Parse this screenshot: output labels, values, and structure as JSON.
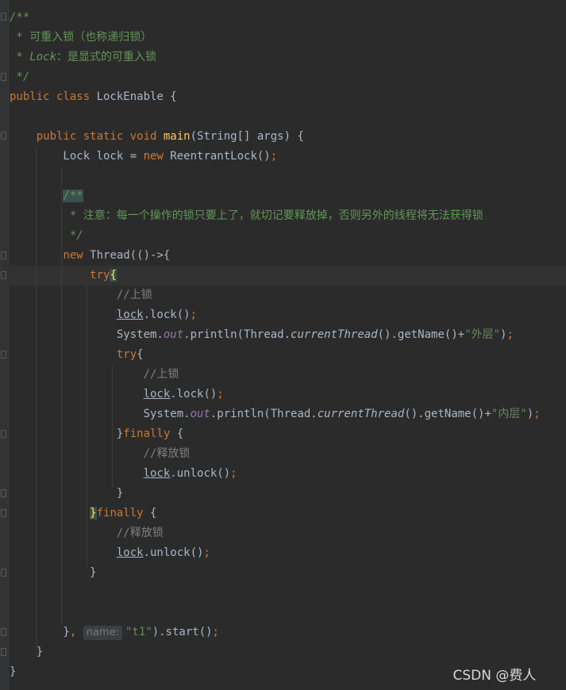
{
  "editor": {
    "language": "java",
    "lines": [
      {
        "tokens": [
          {
            "t": "/**",
            "c": "tok-comment"
          }
        ]
      },
      {
        "tokens": [
          {
            "t": " * 可重入锁（也称递归锁）",
            "c": "tok-doc"
          }
        ]
      },
      {
        "tokens": [
          {
            "t": " * ",
            "c": "tok-doc"
          },
          {
            "t": "Lock",
            "c": "tok-comment"
          },
          {
            "t": "：是显式的可重入锁",
            "c": "tok-doc"
          }
        ]
      },
      {
        "tokens": [
          {
            "t": " */",
            "c": "tok-comment"
          }
        ]
      },
      {
        "tokens": [
          {
            "t": "public class ",
            "c": "tok-kw"
          },
          {
            "t": "LockEnable {",
            "c": ""
          }
        ]
      },
      {
        "tokens": []
      },
      {
        "tokens": [
          {
            "t": "    public static void ",
            "c": "tok-kw"
          },
          {
            "t": "main",
            "c": "tok-method"
          },
          {
            "t": "(String[] args) {",
            "c": ""
          }
        ]
      },
      {
        "tokens": [
          {
            "t": "        Lock lock = ",
            "c": ""
          },
          {
            "t": "new ",
            "c": "tok-kw"
          },
          {
            "t": "ReentrantLock()",
            "c": ""
          },
          {
            "t": ";",
            "c": "tok-semicolon"
          }
        ]
      },
      {
        "tokens": []
      },
      {
        "tokens": [
          {
            "t": "        ",
            "c": ""
          },
          {
            "t": "/**",
            "c": "tok-comment tok-doc-hl"
          }
        ]
      },
      {
        "tokens": [
          {
            "t": "         * 注意：每一个操作的锁只要上了，就切记要释放掉，否则另外的线程将无法获得锁",
            "c": "tok-doc"
          }
        ]
      },
      {
        "tokens": [
          {
            "t": "         */",
            "c": "tok-comment"
          }
        ]
      },
      {
        "tokens": [
          {
            "t": "        ",
            "c": ""
          },
          {
            "t": "new ",
            "c": "tok-kw"
          },
          {
            "t": "Thread(()->{",
            "c": ""
          }
        ]
      },
      {
        "tokens": [
          {
            "t": "            ",
            "c": ""
          },
          {
            "t": "try",
            "c": "tok-kw"
          },
          {
            "t": "{",
            "c": "tok-brace-hl"
          }
        ]
      },
      {
        "tokens": [
          {
            "t": "                ",
            "c": ""
          },
          {
            "t": "//上锁",
            "c": "tok-line-comment"
          }
        ]
      },
      {
        "tokens": [
          {
            "t": "                ",
            "c": ""
          },
          {
            "t": "lock",
            "c": "tok-underline"
          },
          {
            "t": ".lock()",
            "c": ""
          },
          {
            "t": ";",
            "c": "tok-semicolon"
          }
        ]
      },
      {
        "tokens": [
          {
            "t": "                System.",
            "c": ""
          },
          {
            "t": "out",
            "c": "tok-static"
          },
          {
            "t": ".println(Thread.",
            "c": ""
          },
          {
            "t": "currentThread",
            "c": "tok-italic"
          },
          {
            "t": "().getName()+",
            "c": ""
          },
          {
            "t": "\"外层\"",
            "c": "tok-str"
          },
          {
            "t": ")",
            "c": ""
          },
          {
            "t": ";",
            "c": "tok-semicolon"
          }
        ]
      },
      {
        "tokens": [
          {
            "t": "                ",
            "c": ""
          },
          {
            "t": "try",
            "c": "tok-kw"
          },
          {
            "t": "{",
            "c": ""
          }
        ]
      },
      {
        "tokens": [
          {
            "t": "                    ",
            "c": ""
          },
          {
            "t": "//上锁",
            "c": "tok-line-comment"
          }
        ]
      },
      {
        "tokens": [
          {
            "t": "                    ",
            "c": ""
          },
          {
            "t": "lock",
            "c": "tok-underline"
          },
          {
            "t": ".lock()",
            "c": ""
          },
          {
            "t": ";",
            "c": "tok-semicolon"
          }
        ]
      },
      {
        "tokens": [
          {
            "t": "                    System.",
            "c": ""
          },
          {
            "t": "out",
            "c": "tok-static"
          },
          {
            "t": ".println(Thread.",
            "c": ""
          },
          {
            "t": "currentThread",
            "c": "tok-italic"
          },
          {
            "t": "().getName()+",
            "c": ""
          },
          {
            "t": "\"内层\"",
            "c": "tok-str"
          },
          {
            "t": ")",
            "c": ""
          },
          {
            "t": ";",
            "c": "tok-semicolon"
          }
        ]
      },
      {
        "tokens": [
          {
            "t": "                }",
            "c": ""
          },
          {
            "t": "finally ",
            "c": "tok-kw"
          },
          {
            "t": "{",
            "c": ""
          }
        ]
      },
      {
        "tokens": [
          {
            "t": "                    ",
            "c": ""
          },
          {
            "t": "//释放锁",
            "c": "tok-line-comment"
          }
        ]
      },
      {
        "tokens": [
          {
            "t": "                    ",
            "c": ""
          },
          {
            "t": "lock",
            "c": "tok-underline"
          },
          {
            "t": ".unlock()",
            "c": ""
          },
          {
            "t": ";",
            "c": "tok-semicolon"
          }
        ]
      },
      {
        "tokens": [
          {
            "t": "                }",
            "c": ""
          }
        ]
      },
      {
        "tokens": [
          {
            "t": "            ",
            "c": ""
          },
          {
            "t": "}",
            "c": "tok-brace-hl"
          },
          {
            "t": "finally ",
            "c": "tok-kw"
          },
          {
            "t": "{",
            "c": ""
          }
        ]
      },
      {
        "tokens": [
          {
            "t": "                ",
            "c": ""
          },
          {
            "t": "//释放锁",
            "c": "tok-line-comment"
          }
        ]
      },
      {
        "tokens": [
          {
            "t": "                ",
            "c": ""
          },
          {
            "t": "lock",
            "c": "tok-underline"
          },
          {
            "t": ".unlock()",
            "c": ""
          },
          {
            "t": ";",
            "c": "tok-semicolon"
          }
        ]
      },
      {
        "tokens": [
          {
            "t": "            }",
            "c": ""
          }
        ]
      },
      {
        "tokens": []
      },
      {
        "tokens": []
      },
      {
        "tokens": [
          {
            "t": "        }",
            "c": ""
          },
          {
            "t": ", ",
            "c": "tok-semicolon"
          },
          {
            "t": "name:",
            "c": "hint"
          },
          {
            "t": "\"t1\"",
            "c": "tok-str"
          },
          {
            "t": ").start()",
            "c": ""
          },
          {
            "t": ";",
            "c": "tok-semicolon"
          }
        ]
      },
      {
        "tokens": [
          {
            "t": "    }",
            "c": ""
          }
        ]
      },
      {
        "tokens": [
          {
            "t": "}",
            "c": ""
          }
        ]
      }
    ]
  },
  "watermark": {
    "text": "CSDN @费人 󠀠 󠀠 󠀠 󠀠"
  }
}
